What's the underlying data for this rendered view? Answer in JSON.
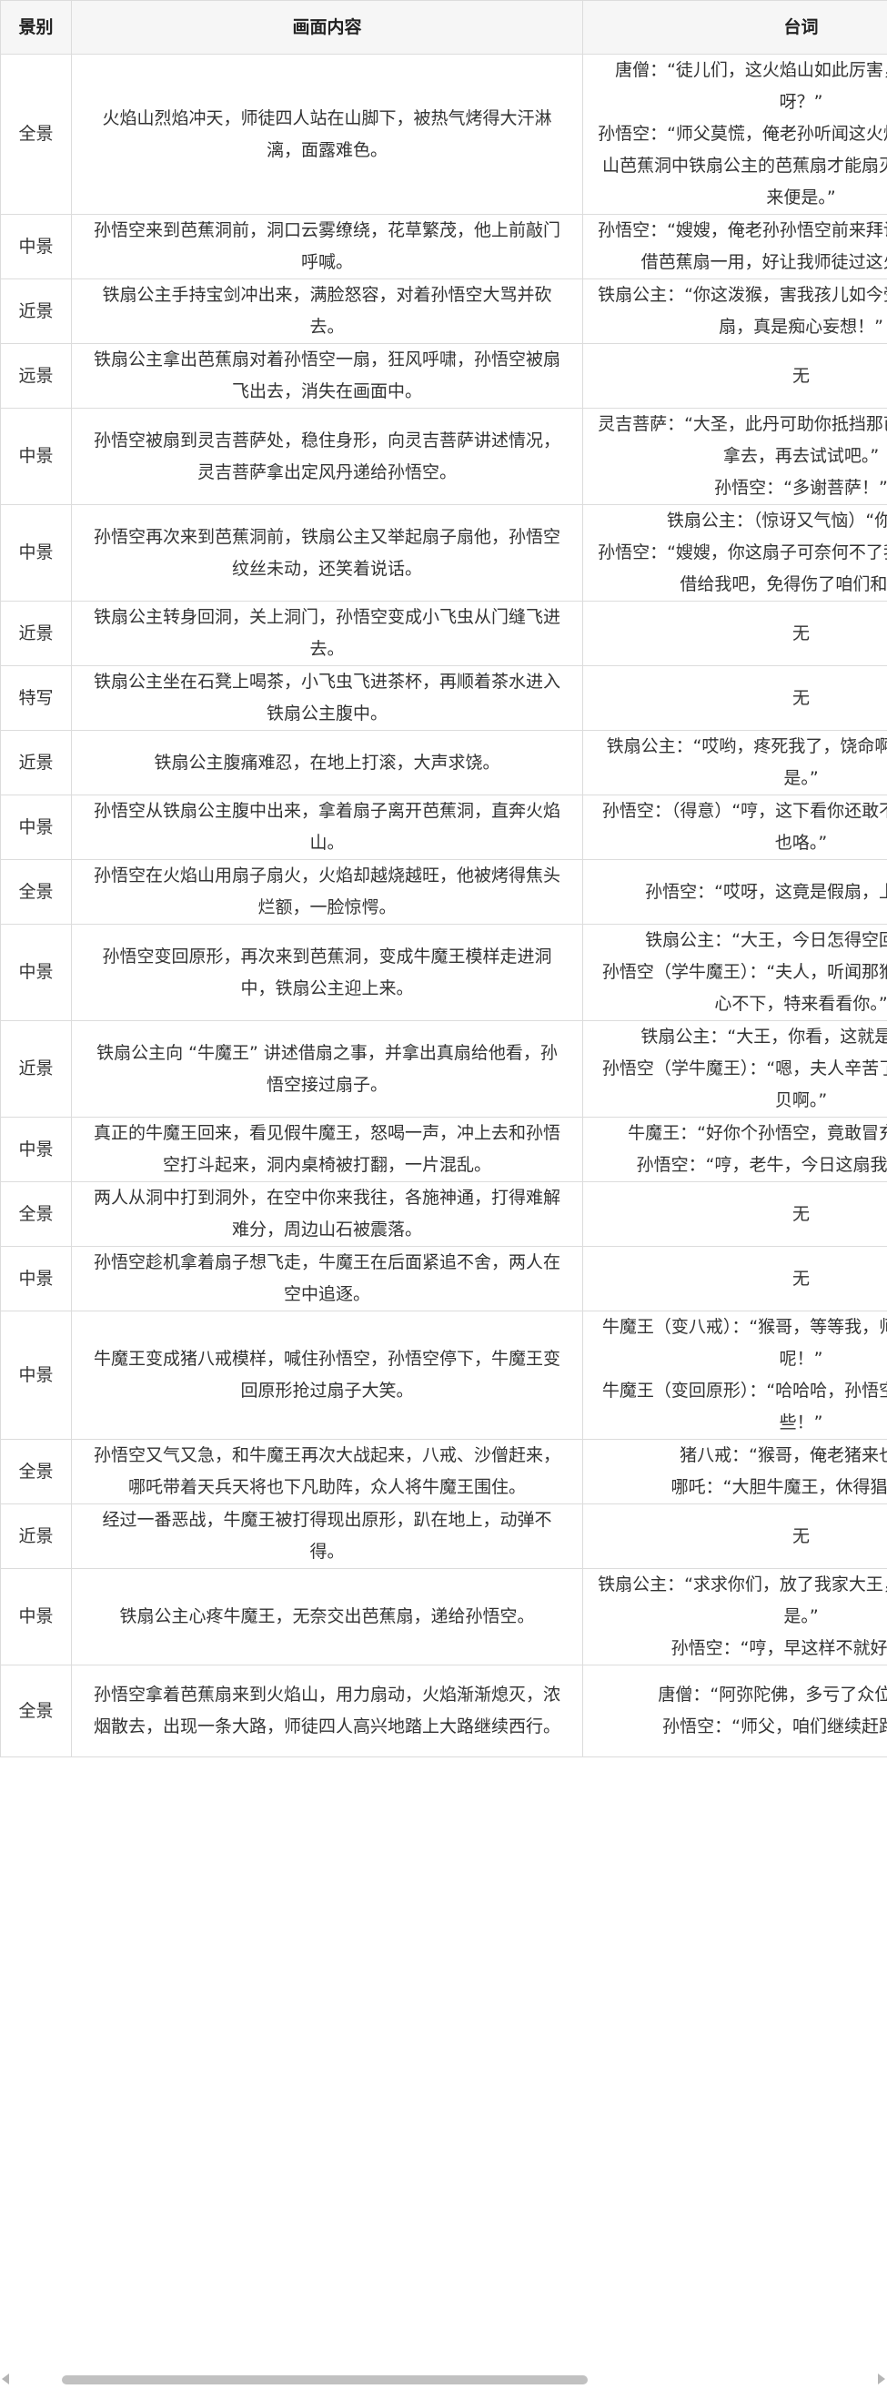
{
  "headers": [
    "景别",
    "画面内容",
    "台词"
  ],
  "rows": [
    {
      "shot": "全景",
      "content": "火焰山烈焰冲天，师徒四人站在山脚下，被热气烤得大汗淋漓，面露难色。",
      "dialog": [
        "唐僧：“徒儿们，这火焰山如此厉害，该如何是好呀？”",
        "孙悟空：“师父莫慌，俺老孙听闻这火焰山可用那翠云山芭蕉洞中铁扇公主的芭蕉扇才能扇灭，俺这就去借来便是。”"
      ]
    },
    {
      "shot": "中景",
      "content": "孙悟空来到芭蕉洞前，洞口云雾缭绕，花草繁茂，他上前敲门呼喊。",
      "dialog": [
        "孙悟空：“嫂嫂，俺老孙孙悟空前来拜访，行个方便，借芭蕉扇一用，好让我师徒过这火焰山！”"
      ]
    },
    {
      "shot": "近景",
      "content": "铁扇公主手持宝剑冲出来，满脸怒容，对着孙悟空大骂并砍去。",
      "dialog": [
        "铁扇公主：“你这泼猴，害我孩儿如今受苦，还敢来借扇，真是痴心妄想！”"
      ]
    },
    {
      "shot": "远景",
      "content": "铁扇公主拿出芭蕉扇对着孙悟空一扇，狂风呼啸，孙悟空被扇飞出去，消失在画面中。",
      "dialog": [
        "无"
      ]
    },
    {
      "shot": "中景",
      "content": "孙悟空被扇到灵吉菩萨处，稳住身形，向灵吉菩萨讲述情况，灵吉菩萨拿出定风丹递给孙悟空。",
      "dialog": [
        "灵吉菩萨：“大圣，此丹可助你抵挡那芭蕉扇的风力，拿去，再去试试吧。”",
        "孙悟空：“多谢菩萨！”"
      ]
    },
    {
      "shot": "中景",
      "content": "孙悟空再次来到芭蕉洞前，铁扇公主又举起扇子扇他，孙悟空纹丝未动，还笑着说话。",
      "dialog": [
        "铁扇公主：（惊讶又气恼）“你……”",
        "孙悟空：“嫂嫂，你这扇子可奈何不了我了，快把扇子借给我吧，免得伤了咱们和气。”"
      ]
    },
    {
      "shot": "近景",
      "content": "铁扇公主转身回洞，关上洞门，孙悟空变成小飞虫从门缝飞进去。",
      "dialog": [
        "无"
      ]
    },
    {
      "shot": "特写",
      "content": "铁扇公主坐在石凳上喝茶，小飞虫飞进茶杯，再顺着茶水进入铁扇公主腹中。",
      "dialog": [
        "无"
      ]
    },
    {
      "shot": "近景",
      "content": "铁扇公主腹痛难忍，在地上打滚，大声求饶。",
      "dialog": [
        "铁扇公主：“哎哟，疼死我了，饶命啊，扇子借你便是。”"
      ]
    },
    {
      "shot": "中景",
      "content": "孙悟空从铁扇公主腹中出来，拿着扇子离开芭蕉洞，直奔火焰山。",
      "dialog": [
        "孙悟空：（得意）“哼，这下看你还敢不借，俺老孙去也咯。”"
      ]
    },
    {
      "shot": "全景",
      "content": "孙悟空在火焰山用扇子扇火，火焰却越烧越旺，他被烤得焦头烂额，一脸惊愕。",
      "dialog": [
        "孙悟空：“哎呀，这竟是假扇，上当了！”"
      ]
    },
    {
      "shot": "中景",
      "content": "孙悟空变回原形，再次来到芭蕉洞，变成牛魔王模样走进洞中，铁扇公主迎上来。",
      "dialog": [
        "铁扇公主：“大王，今日怎得空回来了？”",
        "孙悟空（学牛魔王）：“夫人，听闻那猴子来借扇，我心不下，特来看看你。”"
      ]
    },
    {
      "shot": "近景",
      "content": "铁扇公主向 “牛魔王” 讲述借扇之事，并拿出真扇给他看，孙悟空接过扇子。",
      "dialog": [
        "铁扇公主：“大王，你看，这就是真扇了。”",
        "孙悟空（学牛魔王）：“嗯，夫人辛苦了，这可是个宝贝啊。”"
      ]
    },
    {
      "shot": "中景",
      "content": "真正的牛魔王回来，看见假牛魔王，怒喝一声，冲上去和孙悟空打斗起来，洞内桌椅被打翻，一片混乱。",
      "dialog": [
        "牛魔王：“好你个孙悟空，竟敢冒充俺老牛！”",
        "孙悟空：“哼，老牛，今日这扇我要定了！”"
      ]
    },
    {
      "shot": "全景",
      "content": "两人从洞中打到洞外，在空中你来我往，各施神通，打得难解难分，周边山石被震落。",
      "dialog": [
        "无"
      ]
    },
    {
      "shot": "中景",
      "content": "孙悟空趁机拿着扇子想飞走，牛魔王在后面紧追不舍，两人在空中追逐。",
      "dialog": [
        "无"
      ]
    },
    {
      "shot": "中景",
      "content": "牛魔王变成猪八戒模样，喊住孙悟空，孙悟空停下，牛魔王变回原形抢过扇子大笑。",
      "dialog": [
        "牛魔王（变八戒）：“猴哥，等等我，师父让我来帮你呢！”",
        "牛魔王（变回原形）：“哈哈哈，孙悟空，你还是嫩了些！”"
      ]
    },
    {
      "shot": "全景",
      "content": "孙悟空又气又急，和牛魔王再次大战起来，八戒、沙僧赶来，哪吒带着天兵天将也下凡助阵，众人将牛魔王围住。",
      "dialog": [
        "猪八戒：“猴哥，俺老猪来也！”",
        "哪吒：“大胆牛魔王，休得猖狂！”"
      ]
    },
    {
      "shot": "近景",
      "content": "经过一番恶战，牛魔王被打得现出原形，趴在地上，动弹不得。",
      "dialog": [
        "无"
      ]
    },
    {
      "shot": "中景",
      "content": "铁扇公主心疼牛魔王，无奈交出芭蕉扇，递给孙悟空。",
      "dialog": [
        "铁扇公主：“求求你们，放了我家大王，扇子给你们便是。”",
        "孙悟空：“哼，早这样不就好了！”"
      ]
    },
    {
      "shot": "全景",
      "content": "孙悟空拿着芭蕉扇来到火焰山，用力扇动，火焰渐渐熄灭，浓烟散去，出现一条大路，师徒四人高兴地踏上大路继续西行。",
      "dialog": [
        "唐僧：“阿弥陀佛，多亏了众位相助。”",
        "孙悟空：“师父，咱们继续赶路吧！”"
      ]
    }
  ]
}
